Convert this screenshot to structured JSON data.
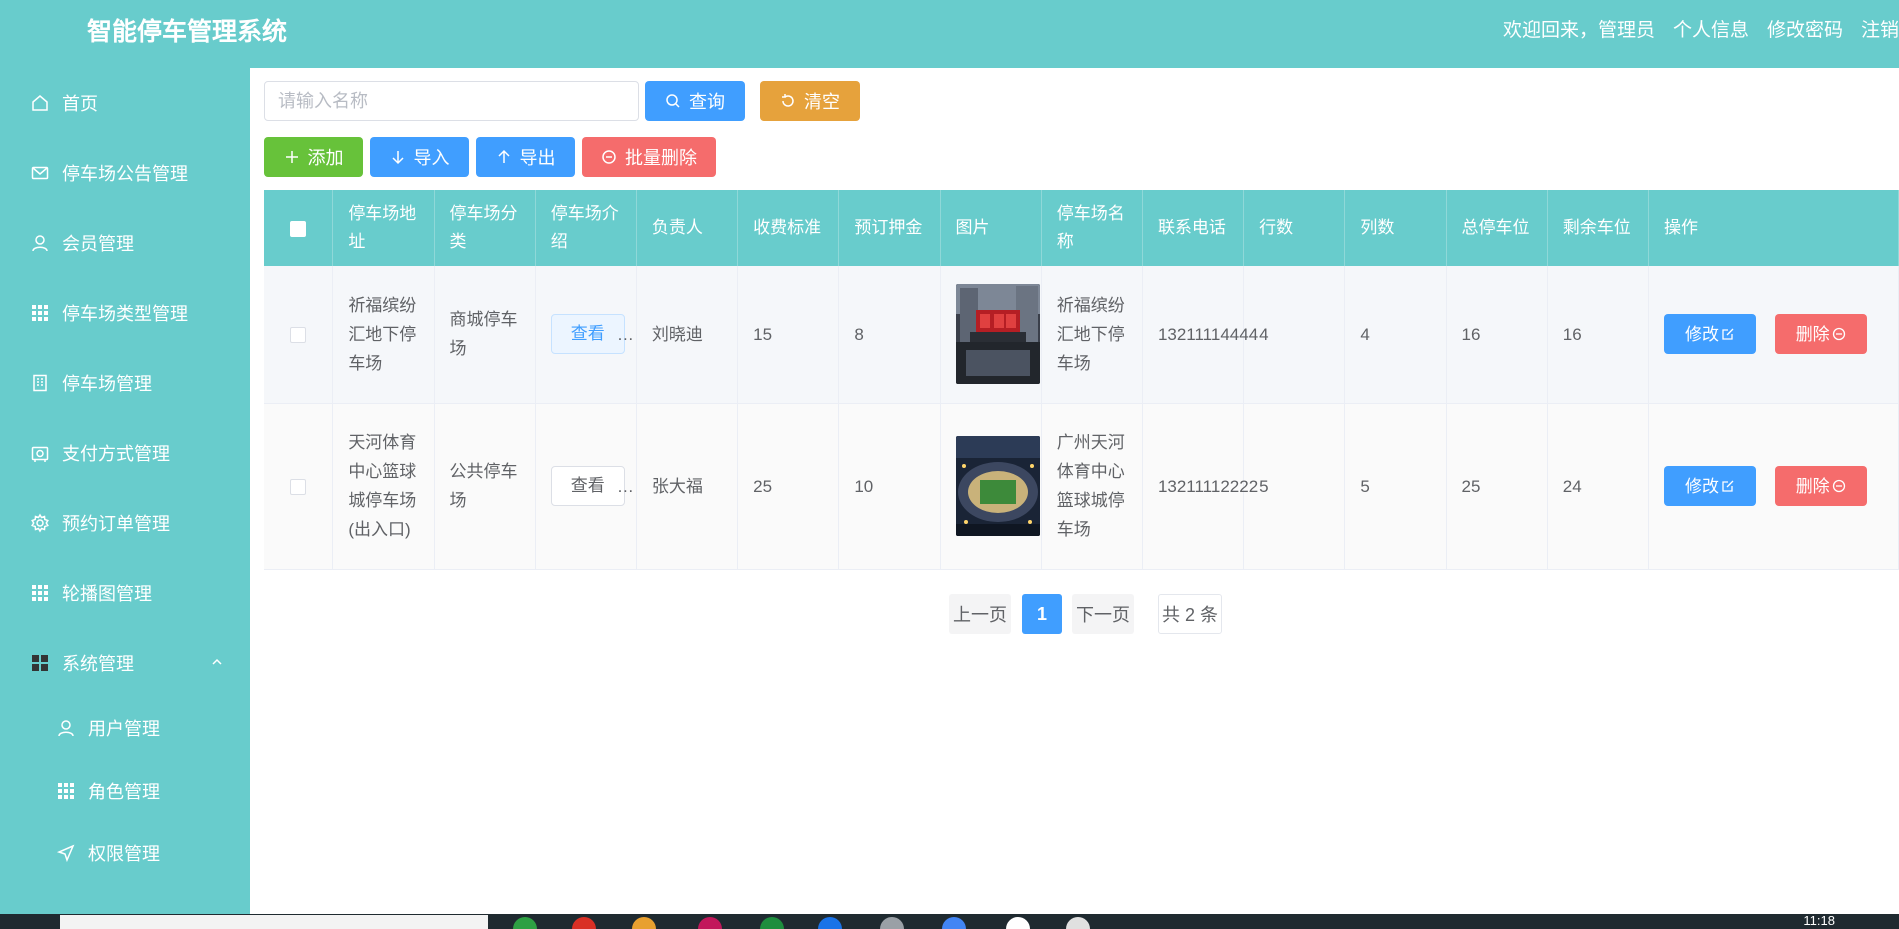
{
  "header": {
    "title": "智能停车管理系统",
    "welcome": "欢迎回来，管理员",
    "links": [
      "个人信息",
      "修改密码",
      "注销"
    ]
  },
  "sidebar": {
    "items": [
      {
        "label": "首页",
        "icon": "home-icon"
      },
      {
        "label": "停车场公告管理",
        "icon": "message-icon"
      },
      {
        "label": "会员管理",
        "icon": "user-icon"
      },
      {
        "label": "停车场类型管理",
        "icon": "grid-icon"
      },
      {
        "label": "停车场管理",
        "icon": "office-building-icon"
      },
      {
        "label": "支付方式管理",
        "icon": "wallet-icon"
      },
      {
        "label": "预约订单管理",
        "icon": "gear-icon"
      },
      {
        "label": "轮播图管理",
        "icon": "grid-icon"
      },
      {
        "label": "系统管理",
        "icon": "menu-icon",
        "expanded": true
      },
      {
        "label": "用户管理",
        "icon": "user-icon"
      },
      {
        "label": "角色管理",
        "icon": "grid-icon"
      },
      {
        "label": "权限管理",
        "icon": "send-icon"
      }
    ]
  },
  "toolbar": {
    "search_placeholder": "请输入名称",
    "query_label": "查询",
    "clear_label": "清空",
    "add_label": "添加",
    "import_label": "导入",
    "export_label": "导出",
    "batch_delete_label": "批量删除"
  },
  "table": {
    "columns": [
      "停车场地址",
      "停车场分类",
      "停车场介绍",
      "负责人",
      "收费标准",
      "预订押金",
      "图片",
      "停车场名称",
      "联系电话",
      "行数",
      "列数",
      "总停车位",
      "剩余车位",
      "操作"
    ],
    "view_label": "查看",
    "ellipsis": "…",
    "edit_label": "修改",
    "delete_label": "删除",
    "rows": [
      {
        "address": "祈福缤纷汇地下停车场",
        "category": "商城停车场",
        "manager": "刘晓迪",
        "fee": "15",
        "deposit": "8",
        "image": "mall-parking-photo",
        "name": "祈福缤纷汇地下停车场",
        "phone": "13211114444",
        "rows": "4",
        "cols": "4",
        "total": "16",
        "remaining": "16"
      },
      {
        "address": "天河体育中心篮球城停车场(出入口)",
        "category": "公共停车场",
        "manager": "张大福",
        "fee": "25",
        "deposit": "10",
        "image": "stadium-night-photo",
        "name": "广州天河体育中心篮球城停车场",
        "phone": "13211112222",
        "rows": "5",
        "cols": "5",
        "total": "25",
        "remaining": "24"
      }
    ]
  },
  "pagination": {
    "prev_label": "上一页",
    "current_page": "1",
    "next_label": "下一页",
    "total_label": "共 2 条"
  },
  "taskbar": {
    "clock": "11:18"
  },
  "colors": {
    "theme": "#68cccc",
    "primary": "#409eff",
    "warning": "#e6a23c",
    "success": "#67c23a",
    "danger": "#f56c6c"
  }
}
